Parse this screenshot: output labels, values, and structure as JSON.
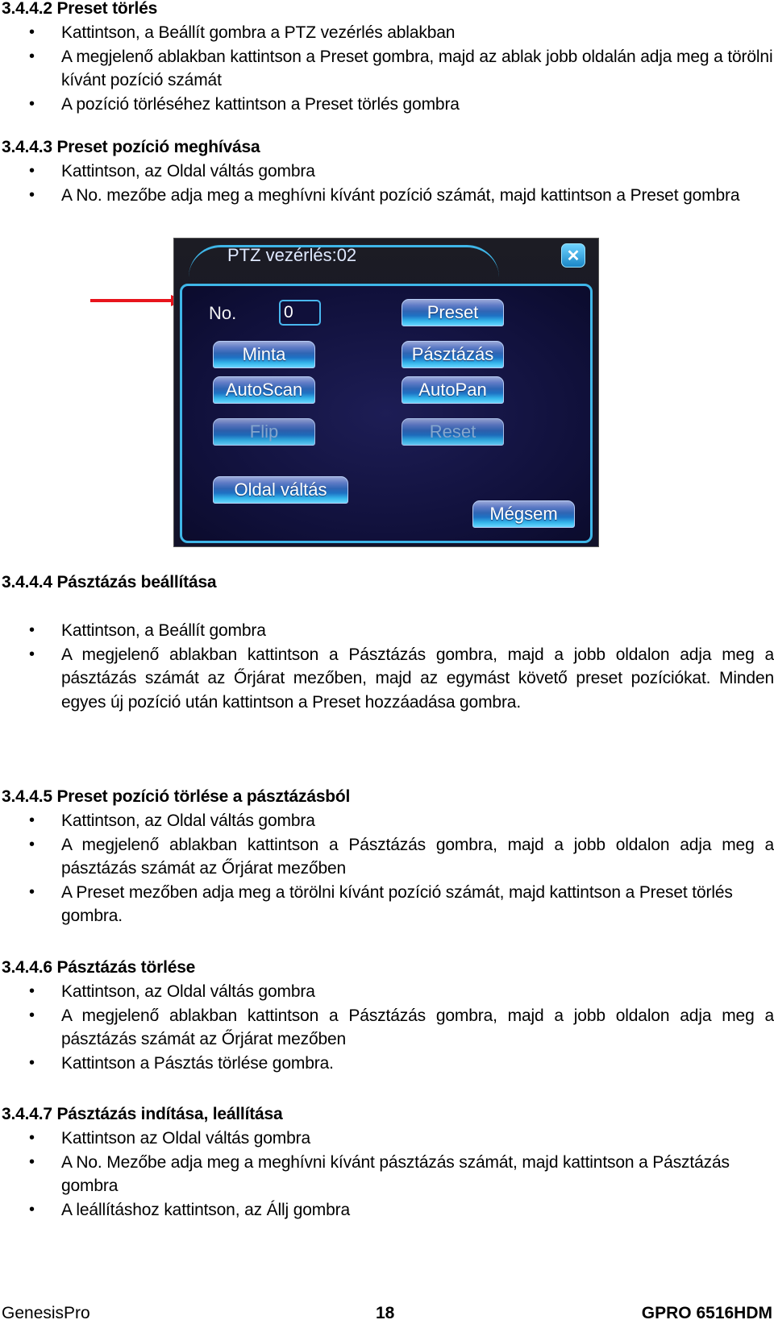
{
  "sections": [
    {
      "heading": "3.4.4.2 Preset törlés",
      "bullets": [
        "Kattintson, a Beállít gombra a PTZ vezérlés ablakban",
        "A megjelenő ablakban kattintson a Preset gombra, majd az ablak jobb oldalán adja meg a törölni kívánt pozíció számát",
        "A pozíció törléséhez kattintson a Preset törlés gombra"
      ]
    },
    {
      "heading": "3.4.4.3 Preset pozíció meghívása",
      "bullets": [
        "Kattintson, az Oldal váltás gombra",
        "A No. mezőbe adja meg a meghívni kívánt pozíció számát, majd kattintson a Preset gombra"
      ]
    },
    {
      "heading": "3.4.4.4 Pásztázás beállítása",
      "bullets": [
        "Kattintson, a Beállít gombra",
        "A megjelenő ablakban kattintson a Pásztázás gombra, majd a jobb oldalon adja meg a pásztázás számát az Őrjárat mezőben, majd az egymást követő preset pozíciókat. Minden egyes új pozíció után kattintson a Preset hozzáadása gombra."
      ]
    },
    {
      "heading": "3.4.4.5 Preset pozíció törlése a pásztázásból",
      "bullets": [
        "Kattintson, az Oldal váltás gombra",
        "A megjelenő ablakban kattintson a Pásztázás gombra, majd a jobb oldalon adja meg a pásztázás számát az Őrjárat mezőben",
        "A Preset mezőben adja meg a törölni kívánt pozíció számát, majd kattintson a Preset törlés gombra."
      ]
    },
    {
      "heading": "3.4.4.6 Pásztázás törlése",
      "bullets": [
        "Kattintson, az Oldal váltás gombra",
        "A megjelenő ablakban kattintson a Pásztázás gombra, majd a jobb oldalon adja meg a pásztázás számát az Őrjárat mezőben",
        "Kattintson a Pásztás törlése gombra."
      ]
    },
    {
      "heading": "3.4.4.7 Pásztázás indítása, leállítása",
      "bullets": [
        "Kattintson az Oldal váltás gombra",
        "A No. Mezőbe adja meg a meghívni kívánt pásztázás számát, majd kattintson a Pásztázás gombra",
        "A leállításhoz kattintson, az Állj gombra"
      ]
    }
  ],
  "dialog": {
    "title": "PTZ vezérlés:02",
    "close_icon": "close-x-icon",
    "no_label": "No.",
    "no_value": "0",
    "buttons": {
      "preset": "Preset",
      "minta": "Minta",
      "pasztazas": "Pásztázás",
      "autoscan": "AutoScan",
      "autopan": "AutoPan",
      "flip": "Flip",
      "reset": "Reset",
      "oldal_valtas": "Oldal váltás",
      "megsem": "Mégsem"
    },
    "disabled_buttons": [
      "Flip",
      "Reset"
    ],
    "colors": {
      "accent": "#3fb6e8",
      "background": "#10103a",
      "annotation_arrow": "#e8141c"
    }
  },
  "footer": {
    "left": "GenesisPro",
    "center": "18",
    "right": "GPRO 6516HDM"
  }
}
